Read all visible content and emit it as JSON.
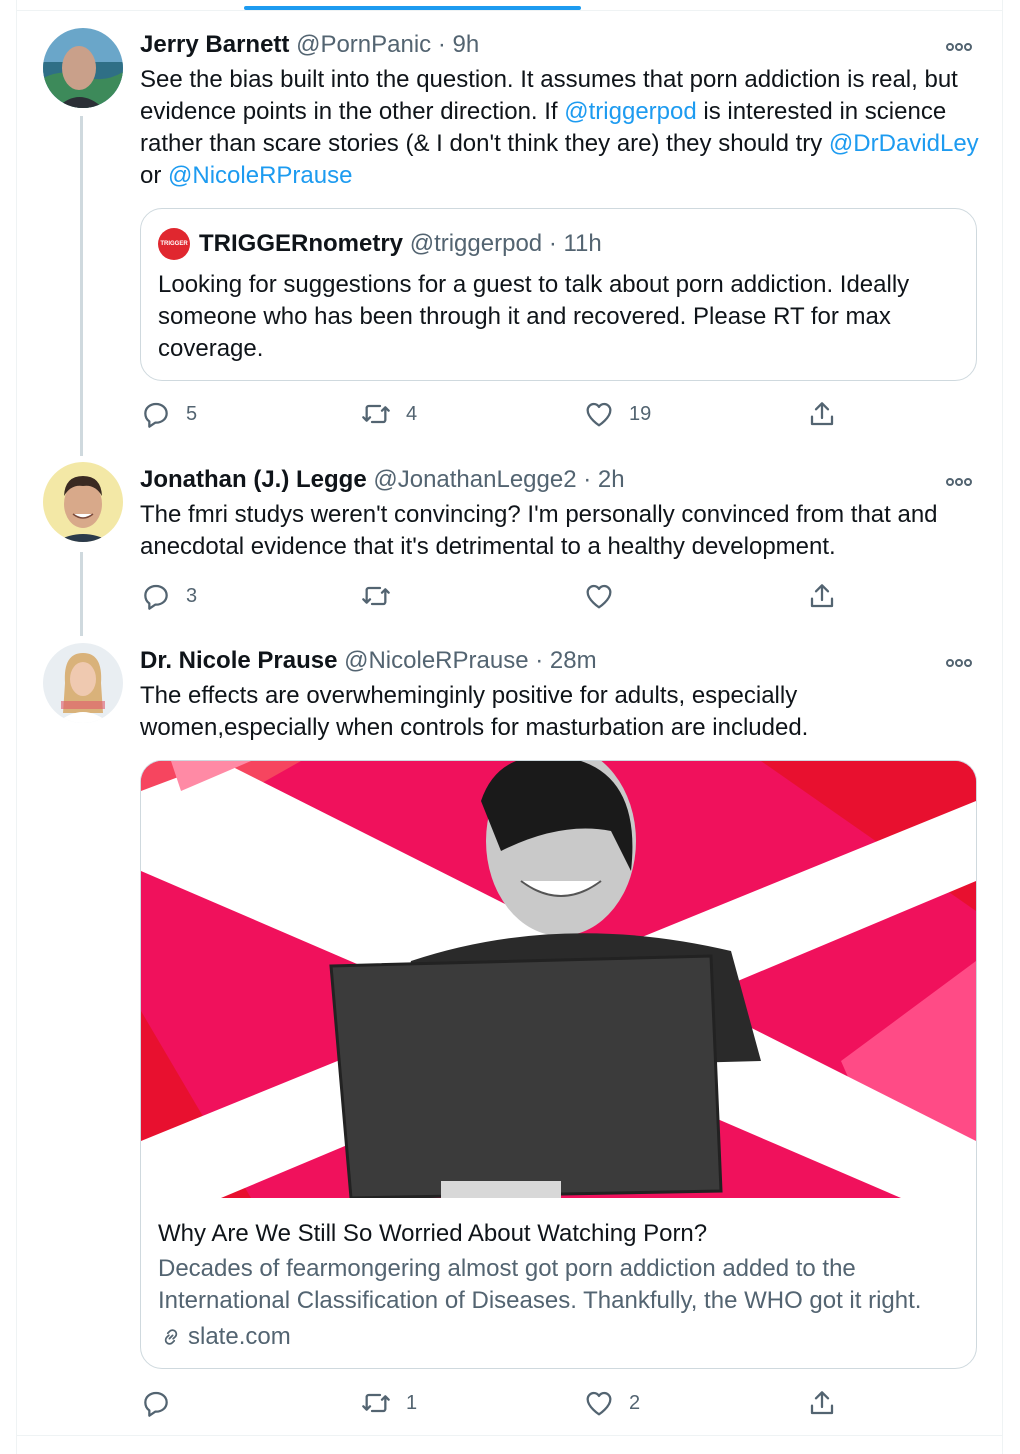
{
  "tweets": [
    {
      "name": "Jerry Barnett",
      "handle": "@PornPanic",
      "sep": "·",
      "time": "9h",
      "text_parts": [
        "See the bias built into the question. It assumes that porn addiction is real, but evidence points in the other direction. If ",
        "@triggerpod",
        " is interested in science rather than scare stories (& I don't think they are) they should try ",
        "@DrDavidLey",
        " or ",
        "@NicoleRPrause"
      ],
      "quote": {
        "logo_text": "TRIGGER",
        "name": "TRIGGERnometry",
        "handle": "@triggerpod",
        "sep": "·",
        "time": "11h",
        "text": "Looking for suggestions for a guest to talk about porn addiction. Ideally someone who has been through it and recovered. Please RT for max coverage."
      },
      "replies": "5",
      "retweets": "4",
      "likes": "19"
    },
    {
      "name": "Jonathan (J.) Legge",
      "handle": "@JonathanLegge2",
      "sep": "·",
      "time": "2h",
      "text": "The fmri studys weren't convincing? I'm personally convinced from that and anecdotal evidence that it's detrimental to a healthy development.",
      "replies": "3"
    },
    {
      "name": "Dr. Nicole Prause",
      "handle": "@NicoleRPrause",
      "sep": "·",
      "time": "28m",
      "text": "The effects are overwheminginly positive for adults, especially women,especially when controls for masturbation are included.",
      "card": {
        "title": "Why Are We Still So Worried About Watching Porn?",
        "description": "Decades of fearmongering almost got porn addiction added to the International Classification of Diseases. Thankfully, the WHO got it right.",
        "domain": "slate.com"
      },
      "retweets": "1",
      "likes": "2"
    }
  ],
  "icons": {
    "reply": "reply-icon",
    "retweet": "retweet-icon",
    "like": "heart-icon",
    "share": "share-icon",
    "more": "more-icon",
    "link": "link-icon"
  },
  "colors": {
    "accent": "#1d9bf0",
    "muted": "#536471",
    "card_bg": "#ef0f58"
  }
}
